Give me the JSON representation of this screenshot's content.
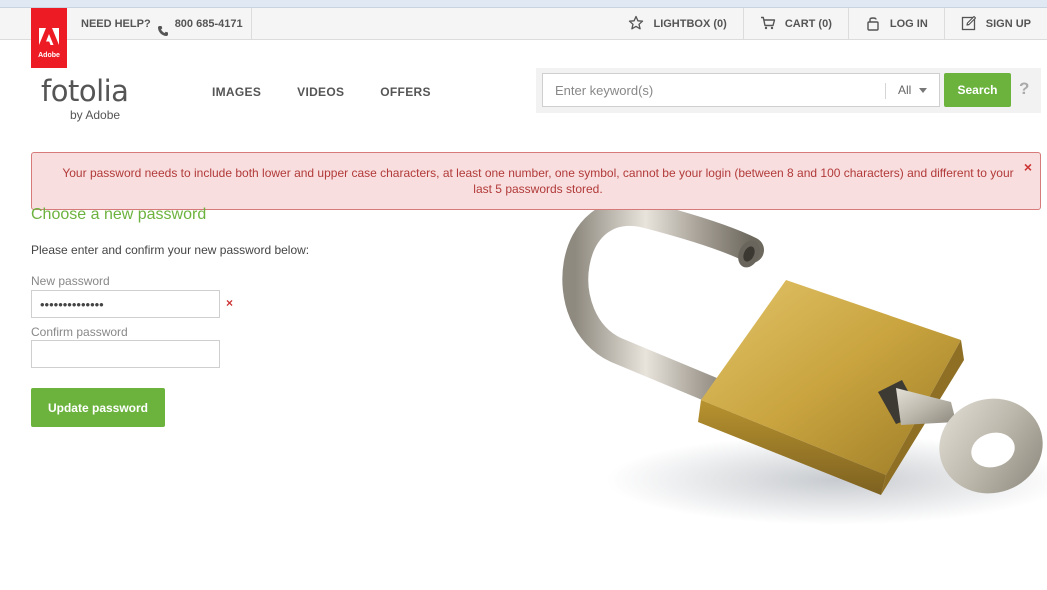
{
  "topbar": {
    "adobe_logo_text": "Adobe",
    "help_label": "NEED HELP?",
    "phone": "800 685-4171",
    "links": [
      {
        "label": "LIGHTBOX (0)",
        "icon": "star-icon"
      },
      {
        "label": "CART (0)",
        "icon": "cart-icon"
      },
      {
        "label": "LOG IN",
        "icon": "lock-icon"
      },
      {
        "label": "SIGN UP",
        "icon": "edit-icon"
      }
    ]
  },
  "header": {
    "brand": "fotolia",
    "brand_sub": "by Adobe",
    "nav": [
      "IMAGES",
      "VIDEOS",
      "OFFERS"
    ],
    "search": {
      "placeholder": "Enter keyword(s)",
      "scope": "All",
      "button": "Search",
      "help": "?"
    }
  },
  "alert": {
    "message": "Your password needs to include both lower and upper case characters, at least one number, one symbol, cannot be your login (between 8 and 100 characters) and different to your last 5 passwords stored.",
    "close": "×"
  },
  "form": {
    "title": "Choose a new password",
    "intro": "Please enter and confirm your new password below:",
    "new_password_label": "New password",
    "new_password_value": "••••••••••••••",
    "confirm_password_label": "Confirm password",
    "confirm_password_value": "",
    "error_mark": "×",
    "submit": "Update password"
  },
  "colors": {
    "accent_green": "#6cb33e",
    "adobe_red": "#ed1c24",
    "error_red": "#b23a3a",
    "alert_bg": "#f8dede"
  }
}
